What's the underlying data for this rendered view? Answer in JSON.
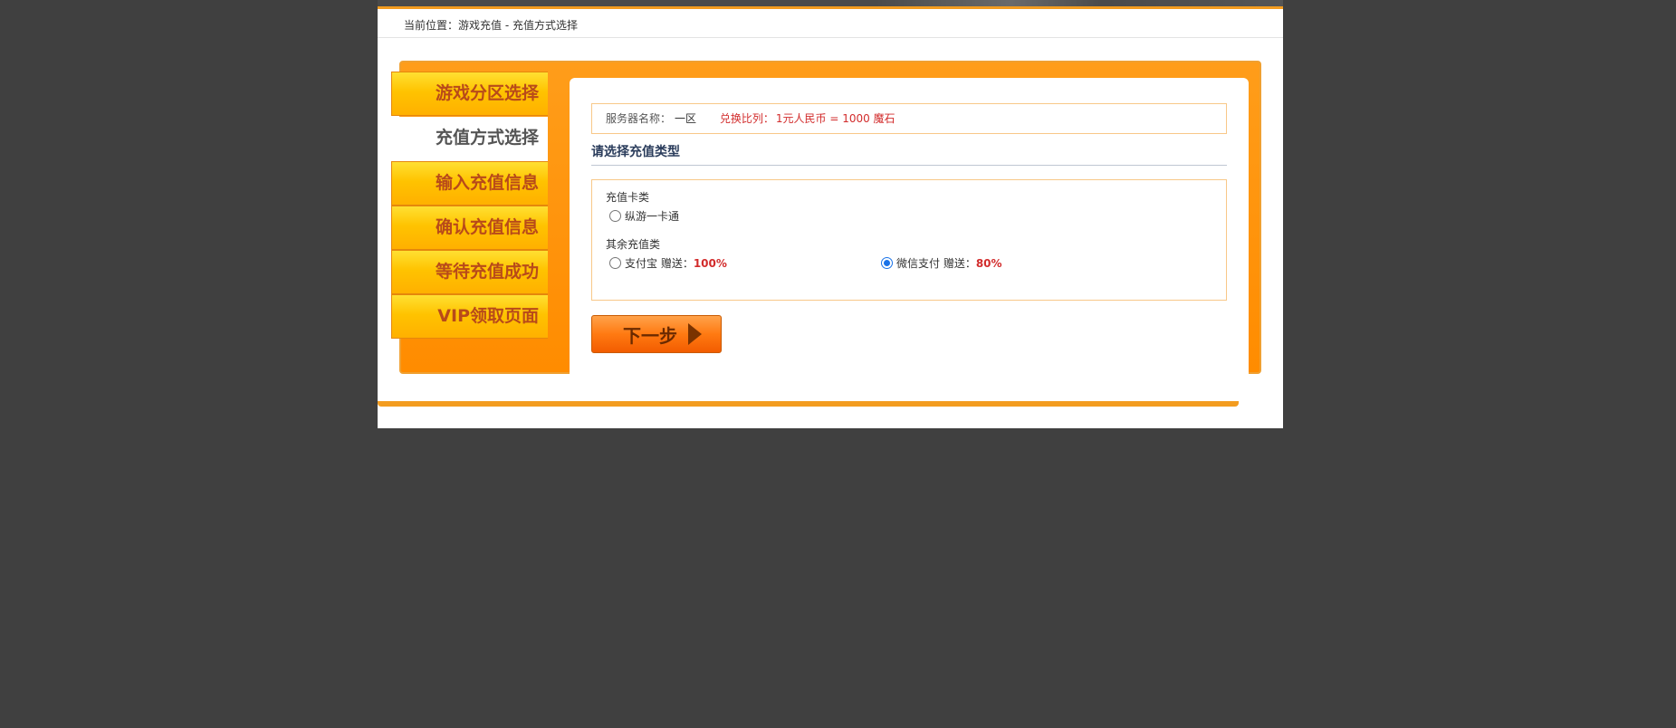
{
  "breadcrumb": {
    "label": "当前位置：",
    "path": "游戏充值 - 充值方式选择"
  },
  "steps": [
    {
      "label": "游戏分区选择",
      "active": false
    },
    {
      "label": "充值方式选择",
      "active": true
    },
    {
      "label": "输入充值信息",
      "active": false
    },
    {
      "label": "确认充值信息",
      "active": false
    },
    {
      "label": "等待充值成功",
      "active": false
    },
    {
      "label": "VIP领取页面",
      "active": false
    }
  ],
  "info": {
    "server_label": "服务器名称：",
    "server_value": "一区",
    "ratio_label": "兑换比列：",
    "ratio_value": "1元人民币 = 1000 魔石"
  },
  "section_title": "请选择充值类型",
  "groups": {
    "card": {
      "label": "充值卡类",
      "options": [
        {
          "label": "纵游一卡通",
          "checked": false
        }
      ]
    },
    "other": {
      "label": "其余充值类",
      "options": [
        {
          "label": "支付宝 赠送：",
          "bonus": "100%",
          "checked": false
        },
        {
          "label": "微信支付 赠送：",
          "bonus": "80%",
          "checked": true
        }
      ]
    }
  },
  "next_button": "下一步",
  "colors": {
    "accent_orange": "#ff9d1a",
    "tab_text": "#b84a1a",
    "highlight_red": "#d22c2c",
    "radio_blue": "#1a73e8"
  }
}
